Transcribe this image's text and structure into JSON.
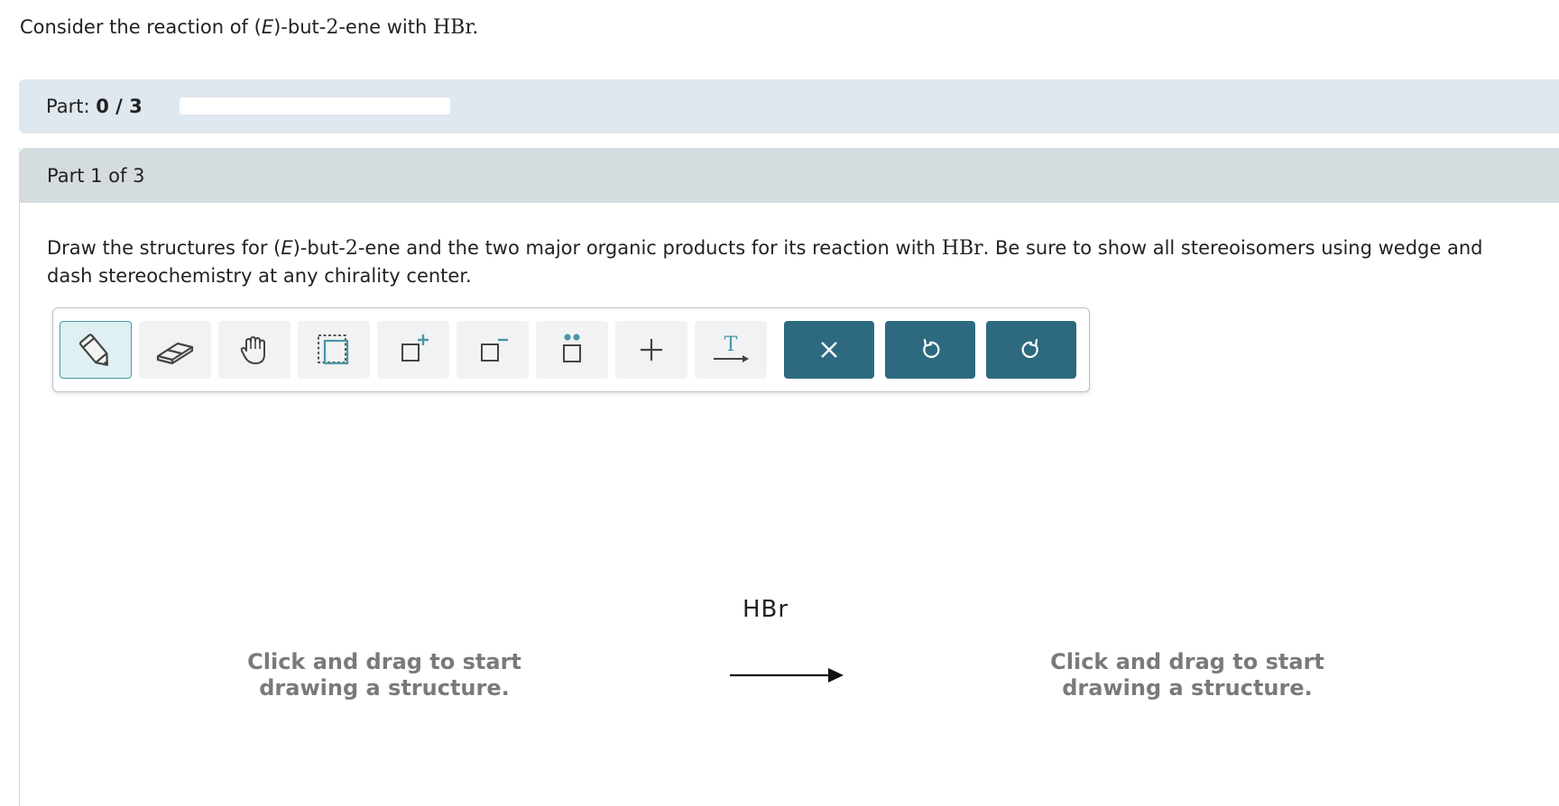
{
  "question": {
    "prefix": "Consider the reaction of (",
    "stereo": "E",
    "name": ")-but-",
    "locant": "2",
    "suffix": "-ene with ",
    "reagent": "HBr",
    "end": "."
  },
  "progress": {
    "label": "Part:",
    "value_text": "0 / 3",
    "completed": 0,
    "total": 3,
    "fill_fraction": 0.0
  },
  "part": {
    "title": "Part 1 of 3"
  },
  "prompt": {
    "p1": "Draw the structures for (",
    "stereo": "E",
    "p2": ")-but-",
    "locant": "2",
    "p3": "-ene and the two major organic products for its reaction with ",
    "reagent": "HBr",
    "p4": ". Be sure to show all stereoisomers using wedge and dash stereochemistry at any chirality center."
  },
  "toolbar": {
    "tools": [
      {
        "name": "draw-tool",
        "icon": "pencil-icon",
        "active": true
      },
      {
        "name": "erase-tool",
        "icon": "eraser-icon",
        "active": false
      },
      {
        "name": "move-tool",
        "icon": "hand-icon",
        "active": false
      },
      {
        "name": "select-tool",
        "icon": "marquee-select-icon",
        "active": false
      },
      {
        "name": "increase-charge-tool",
        "icon": "charge-plus-icon",
        "active": false
      },
      {
        "name": "decrease-charge-tool",
        "icon": "charge-minus-icon",
        "active": false
      },
      {
        "name": "lone-pair-tool",
        "icon": "lone-pair-icon",
        "active": false
      },
      {
        "name": "add-plus-tool",
        "icon": "plus-icon",
        "active": false
      },
      {
        "name": "reaction-arrow-tool",
        "icon": "text-arrow-icon",
        "active": false
      }
    ],
    "actions": [
      {
        "name": "clear-button",
        "icon": "close-icon"
      },
      {
        "name": "undo-button",
        "icon": "undo-icon"
      },
      {
        "name": "redo-button",
        "icon": "redo-icon"
      }
    ]
  },
  "canvas": {
    "reactant_hint": "Click and drag to start drawing a structure.",
    "product_hint": "Click and drag to start drawing a structure.",
    "reagent": "HBr"
  },
  "colors": {
    "accent": "#2d6a7f",
    "progress_background": "#dfe7ef",
    "part_header_background": "#d5dce0",
    "hint_text": "#7a7a7a",
    "tool_active_border": "#4a97a8"
  }
}
